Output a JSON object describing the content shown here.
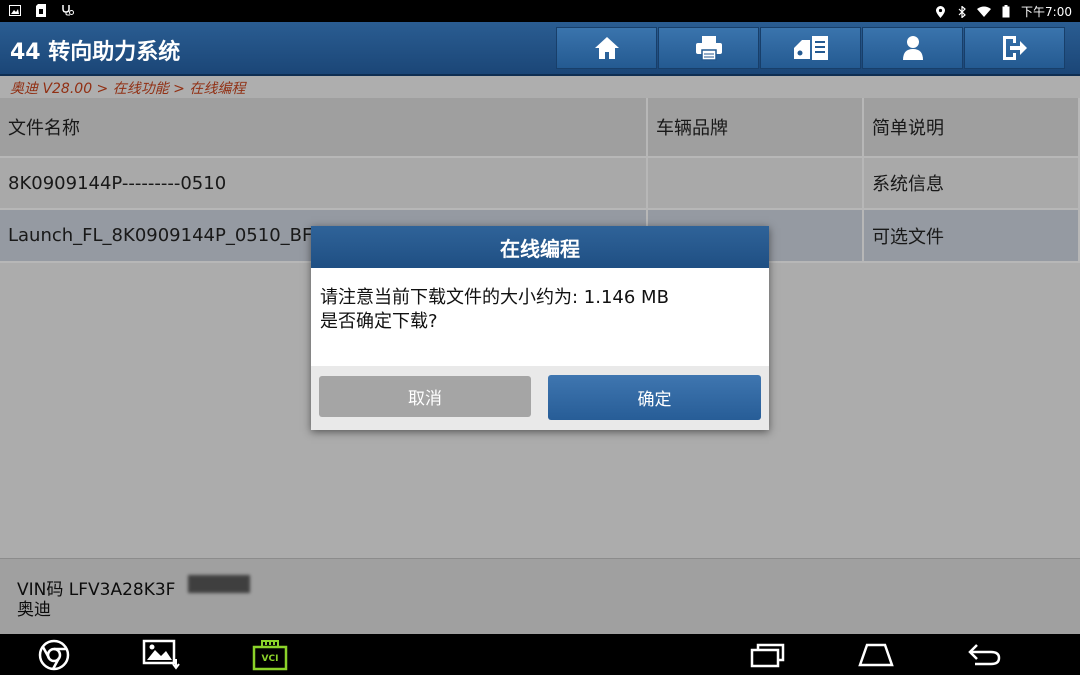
{
  "status_bar": {
    "time": "下午7:00",
    "left_icons": [
      "gallery-notification-icon",
      "sd-card-icon",
      "diagnostic-icon"
    ],
    "right_icons": [
      "location-icon",
      "bluetooth-icon",
      "wifi-icon",
      "battery-icon"
    ]
  },
  "header": {
    "title": "44 转向助力系统",
    "buttons": [
      "home-icon",
      "print-icon",
      "diagnostic-report-icon",
      "user-icon",
      "exit-icon"
    ],
    "color": "#1f4f83"
  },
  "breadcrumb": "奥迪 V28.00 > 在线功能 > 在线编程",
  "table": {
    "columns": [
      "文件名称",
      "车辆品牌",
      "简单说明"
    ],
    "rows": [
      {
        "name": "8K0909144P---------0510",
        "brand": "",
        "desc": "系统信息"
      },
      {
        "name": "Launch_FL_8K0909144P_0510_BF",
        "brand": "",
        "desc": "可选文件"
      }
    ]
  },
  "footer": {
    "vin_label": "VIN码 LFV3A28K3F",
    "make": "奥迪"
  },
  "navbar": {
    "left_icons": [
      "chrome-icon",
      "screenshot-icon",
      "vci-icon"
    ],
    "vci_label": "VCI",
    "right_icons": [
      "recent-apps-icon",
      "home-nav-icon",
      "back-icon"
    ]
  },
  "dialog": {
    "title": "在线编程",
    "message_line1": "请注意当前下载文件的大小约为: 1.146 MB",
    "message_line2": "是否确定下载?",
    "cancel_label": "取消",
    "ok_label": "确定"
  }
}
